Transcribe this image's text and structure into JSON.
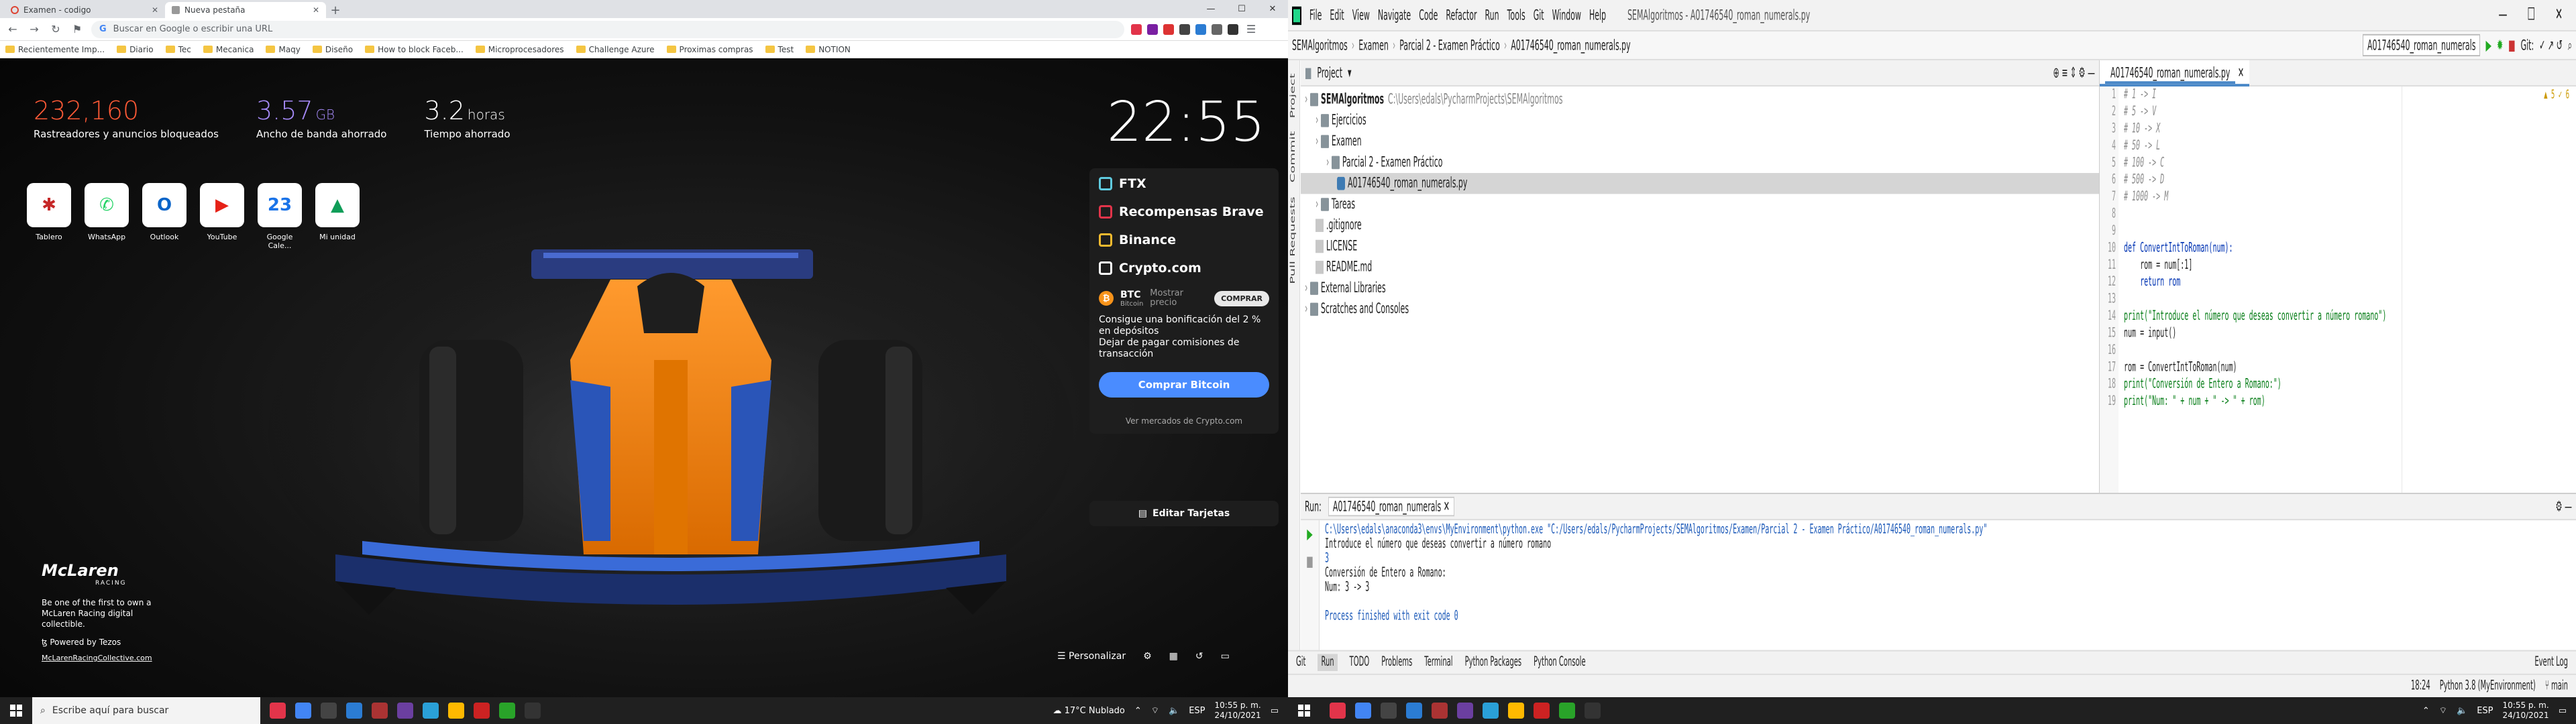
{
  "browser": {
    "tabs": [
      {
        "label": "Examen - codigo",
        "active": false
      },
      {
        "label": "Nueva pestaña",
        "active": true
      }
    ],
    "omnibox_placeholder": "Buscar en Google o escribir una URL",
    "bookmarks": [
      "Recientemente Imp...",
      "Diario",
      "Tec",
      "Mecanica",
      "Maqy",
      "Diseño",
      "How to block Faceb...",
      "Microprocesadores",
      "Challenge Azure",
      "Proximas compras",
      "Test",
      "NOTION"
    ]
  },
  "ntp": {
    "stats": [
      {
        "value": "232,160",
        "unit": "",
        "label": "Rastreadores y anuncios bloqueados",
        "color": "#ff5a36"
      },
      {
        "value": "3.57",
        "unit": "GB",
        "label": "Ancho de banda ahorrado",
        "color": "#a78bfa"
      },
      {
        "value": "3.2",
        "unit": "horas",
        "label": "Tiempo ahorrado",
        "color": "#ffffff"
      }
    ],
    "clock": "22:55",
    "tiles": [
      {
        "label": "Tablero",
        "icon": "tablero-icon",
        "color": "#c62828",
        "glyph": "✱"
      },
      {
        "label": "WhatsApp",
        "icon": "whatsapp-icon",
        "color": "#25d366",
        "glyph": "✆"
      },
      {
        "label": "Outlook",
        "icon": "outlook-icon",
        "color": "#0a64c8",
        "glyph": "O"
      },
      {
        "label": "YouTube",
        "icon": "youtube-icon",
        "color": "#e62117",
        "glyph": "▶"
      },
      {
        "label": "Google Cale...",
        "icon": "calendar-icon",
        "color": "#1a73e8",
        "glyph": "23"
      },
      {
        "label": "Mi unidad",
        "icon": "drive-icon",
        "color": "#0f9d58",
        "glyph": "▲"
      }
    ],
    "mclaren": {
      "logo": "McLaren",
      "sub": "RACING",
      "text": "Be one of the first to own a McLaren Racing digital collectible.",
      "powered": "Powered by Tezos",
      "link": "McLarenRacingCollective.com"
    },
    "cards": {
      "items": [
        {
          "label": "FTX",
          "color": "#5fcade"
        },
        {
          "label": "Recompensas Brave",
          "color": "#e2344a"
        },
        {
          "label": "Binance",
          "color": "#f3ba2f"
        },
        {
          "label": "Crypto.com",
          "color": "#ffffff"
        }
      ],
      "btc_symbol": "BTC",
      "btc_name": "Bitcoin",
      "show_price": "Mostrar precio",
      "buy_label": "COMPRAR",
      "promo_1": "Consigue una bonificación del 2 % en depósitos",
      "promo_2": "Dejar de pagar comisiones de transacción",
      "cta": "Comprar Bitcoin",
      "more": "Ver mercados de Crypto.com"
    },
    "edit_cards": "Editar Tarjetas",
    "customize": "Personalizar"
  },
  "ide": {
    "menus": [
      "File",
      "Edit",
      "View",
      "Navigate",
      "Code",
      "Refactor",
      "Run",
      "Tools",
      "Git",
      "Window",
      "Help"
    ],
    "title": "SEMAlgoritmos - A01746540_roman_numerals.py",
    "breadcrumbs": [
      "SEMAlgoritmos",
      "Examen",
      "Parcial 2 - Examen Práctico",
      "A01746540_roman_numerals.py"
    ],
    "run_config": "A01746540_roman_numerals",
    "git_label": "Git:",
    "project_label": "Project",
    "tree": [
      {
        "text": "SEMAlgoritmos",
        "extra": "C:\\Users\\edals\\PycharmProjects\\SEMAlgoritmos",
        "indent": 0,
        "type": "fo",
        "bold": true
      },
      {
        "text": "Ejercicios",
        "extra": "",
        "indent": 1,
        "type": "fo"
      },
      {
        "text": "Examen",
        "extra": "",
        "indent": 1,
        "type": "fo"
      },
      {
        "text": "Parcial 2 - Examen Práctico",
        "extra": "",
        "indent": 2,
        "type": "fo"
      },
      {
        "text": "A01746540_roman_numerals.py",
        "extra": "",
        "indent": 3,
        "type": "py",
        "sel": true
      },
      {
        "text": "Tareas",
        "extra": "",
        "indent": 1,
        "type": "fo"
      },
      {
        "text": ".gitignore",
        "extra": "",
        "indent": 1,
        "type": "tx"
      },
      {
        "text": "LICENSE",
        "extra": "",
        "indent": 1,
        "type": "tx"
      },
      {
        "text": "README.md",
        "extra": "",
        "indent": 1,
        "type": "tx"
      },
      {
        "text": "External Libraries",
        "extra": "",
        "indent": 0,
        "type": "fo"
      },
      {
        "text": "Scratches and Consoles",
        "extra": "",
        "indent": 0,
        "type": "fo"
      }
    ],
    "editor_tab": "A01746540_roman_numerals.py",
    "warnings": "▲ 5  ✓ 6",
    "code": [
      {
        "cls": "cm",
        "text": "# 1 -> I"
      },
      {
        "cls": "cm",
        "text": "# 5 -> V"
      },
      {
        "cls": "cm",
        "text": "# 10 -> X"
      },
      {
        "cls": "cm",
        "text": "# 50 -> L"
      },
      {
        "cls": "cm",
        "text": "# 100 -> C"
      },
      {
        "cls": "cm",
        "text": "# 500 -> D"
      },
      {
        "cls": "cm",
        "text": "# 1000 -> M"
      },
      {
        "cls": "",
        "text": ""
      },
      {
        "cls": "",
        "text": ""
      },
      {
        "cls": "kw",
        "text": "def ConvertIntToRoman(num):"
      },
      {
        "cls": "",
        "text": "    rom = num[:1]"
      },
      {
        "cls": "kw",
        "text": "    return rom"
      },
      {
        "cls": "",
        "text": ""
      },
      {
        "cls": "st",
        "text": "print(\"Introduce el número que deseas convertir a número romano\")"
      },
      {
        "cls": "",
        "text": "num = input()"
      },
      {
        "cls": "",
        "text": ""
      },
      {
        "cls": "",
        "text": "rom = ConvertIntToRoman(num)"
      },
      {
        "cls": "st",
        "text": "print(\"Conversión de Entero a Romano:\")"
      },
      {
        "cls": "st",
        "text": "print(\"Num: \" + num + \" -> \" + rom)"
      }
    ],
    "run_label": "Run:",
    "run_tab": "A01746540_roman_numerals",
    "output": [
      {
        "cls": "path",
        "text": "C:\\Users\\edals\\anaconda3\\envs\\MyEnvironment\\python.exe \"C:/Users/edals/PycharmProjects/SEMAlgoritmos/Examen/Parcial 2 - Examen Práctico/A01746540_roman_numerals.py\""
      },
      {
        "cls": "",
        "text": "Introduce el número que deseas convertir a número romano"
      },
      {
        "cls": "ok",
        "text": "3"
      },
      {
        "cls": "",
        "text": "Conversión de Entero a Romano:"
      },
      {
        "cls": "",
        "text": "Num: 3 -> 3"
      },
      {
        "cls": "",
        "text": ""
      },
      {
        "cls": "ok",
        "text": "Process finished with exit code 0"
      }
    ],
    "tool_tabs": [
      "Git",
      "Run",
      "TODO",
      "Problems",
      "Terminal",
      "Python Packages",
      "Python Console"
    ],
    "event_log": "Event Log",
    "status_pos": "18:24",
    "status_interp": "Python 3.8 (MyEnvironment)",
    "status_branch": "main"
  },
  "taskbar": {
    "search_placeholder": "Escribe aquí para buscar",
    "weather": "17°C  Nublado",
    "lang": "ESP",
    "time": "10:55 p. m.",
    "date": "24/10/2021",
    "apps": [
      "#e2344a",
      "#4285f4",
      "#444",
      "#2b7cd3",
      "#a33",
      "#6b3fa0",
      "#2aa0d8",
      "#ffb900",
      "#cc2222",
      "#29a329",
      "#333"
    ]
  }
}
